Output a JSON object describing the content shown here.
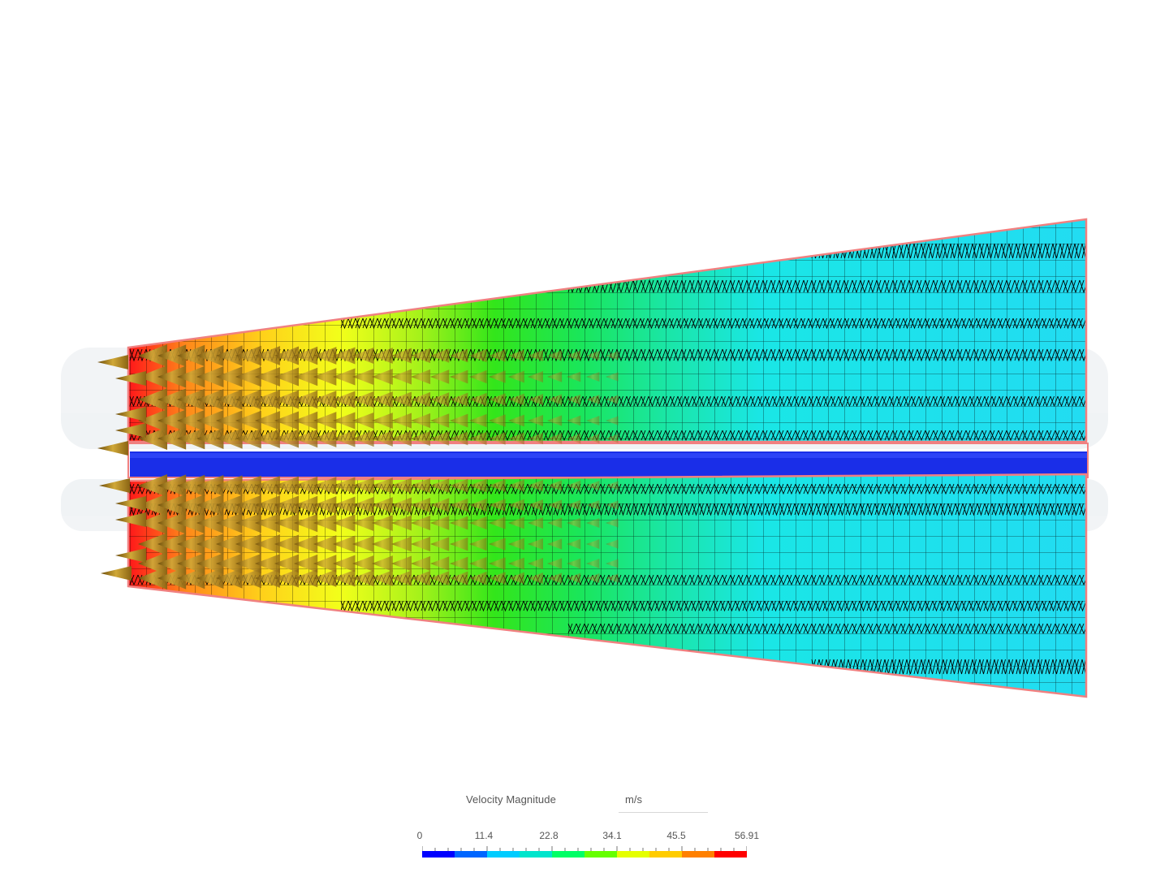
{
  "viewer": {
    "title": "Velocity Magnitude",
    "unit": "m/s"
  },
  "legend": {
    "ticks": [
      "0",
      "11.4",
      "22.8",
      "34.1",
      "45.5",
      "56.91"
    ],
    "min": 0,
    "max": 56.91,
    "colormap": [
      "#0000ff",
      "#0066ff",
      "#00ccff",
      "#00e5cc",
      "#00ff66",
      "#66ff00",
      "#e5ff00",
      "#ffcc00",
      "#ff8000",
      "#ff0000"
    ]
  },
  "colors": {
    "outline": "#f08080",
    "channel": "#1a2ee8",
    "mesh": "#000000",
    "arrow": "#c8a030"
  }
}
